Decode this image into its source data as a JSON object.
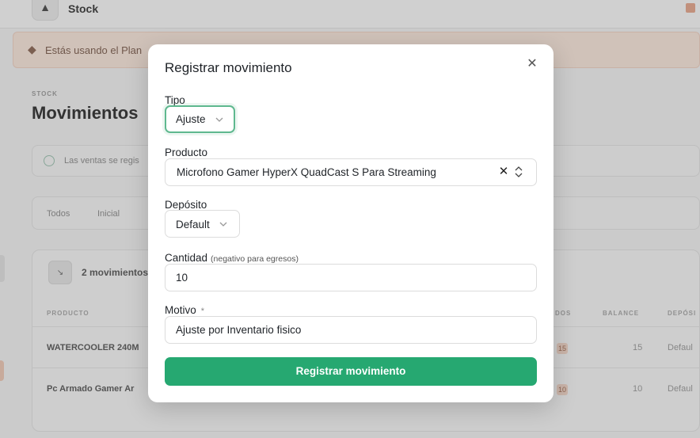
{
  "background": {
    "brand": "Stock",
    "banner_text": "Estás usando el Plan",
    "breadcrumb": "STOCK",
    "page_title": "Movimientos",
    "info_text": "Las ventas se regis",
    "tabs": [
      "Todos",
      "Inicial"
    ],
    "card_title": "2 movimientos",
    "columns": [
      "PRODUCTO",
      "DOS",
      "BALANCE",
      "DEPÓSI"
    ],
    "rows": [
      {
        "product": "WATERCOOLER 240M",
        "qty": "15",
        "balance": "15",
        "deposit": "Defaul"
      },
      {
        "product": "Pc Armado Gamer Ar",
        "qty": "10",
        "balance": "10",
        "deposit": "Defaul"
      }
    ]
  },
  "modal": {
    "title": "Registrar movimiento",
    "close_glyph": "✕",
    "tipo": {
      "label": "Tipo",
      "value": "Ajuste"
    },
    "producto": {
      "label": "Producto",
      "value": "Microfono Gamer HyperX QuadCast S Para Streaming",
      "clear_glyph": "✕"
    },
    "deposito": {
      "label": "Depósito",
      "value": "Default"
    },
    "cantidad": {
      "label": "Cantidad",
      "hint": "(negativo para egresos)",
      "value": "10"
    },
    "motivo": {
      "label": "Motivo",
      "required_mark": "*",
      "value": "Ajuste por Inventario fisico"
    },
    "submit_label": "Registrar movimiento"
  },
  "colors": {
    "accent": "#26a871",
    "focus_ring": "#5fb88f",
    "banner": "#fbe8dd"
  }
}
